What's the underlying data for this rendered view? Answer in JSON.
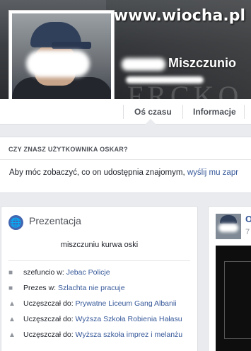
{
  "watermark": "www.wiocha.pl",
  "cover": {
    "letters": "FRCKO"
  },
  "profile": {
    "name": "Miszczunio"
  },
  "tabs": [
    {
      "label": "Oś czasu",
      "active": true
    },
    {
      "label": "Informacje",
      "active": false
    }
  ],
  "know": {
    "title": "CZY ZNASZ UŻYTKOWNIKA OSKAR?",
    "body_prefix": "Aby móc zobaczyć, co on udostępnia znajomym, ",
    "body_link": "wyślij mu zapr"
  },
  "intro": {
    "icon": "globe-icon",
    "title": "Prezentacja",
    "bio": "miszczuniu kurwa oski",
    "items": [
      {
        "icon": "briefcase-icon",
        "prefix": "szefuncio w: ",
        "link": "Jebac Policje"
      },
      {
        "icon": "briefcase-icon",
        "prefix": "Prezes w: ",
        "link": "Szlachta nie pracuje"
      },
      {
        "icon": "graduation-cap-icon",
        "prefix": "Uczęszczał do: ",
        "link": "Prywatne Liceum Gang Albanii"
      },
      {
        "icon": "graduation-cap-icon",
        "prefix": "Uczęszczał do: ",
        "link": "Wyższa Szkoła Robienia Hałasu"
      },
      {
        "icon": "graduation-cap-icon",
        "prefix": "Uczęszczał do: ",
        "link": "Wyższa szkoła imprez i melanżu"
      }
    ]
  },
  "post": {
    "name_initial": "O",
    "time_initial": "7"
  },
  "colors": {
    "link": "#365899",
    "background": "#e9ebee",
    "accent": "#4267b2"
  }
}
